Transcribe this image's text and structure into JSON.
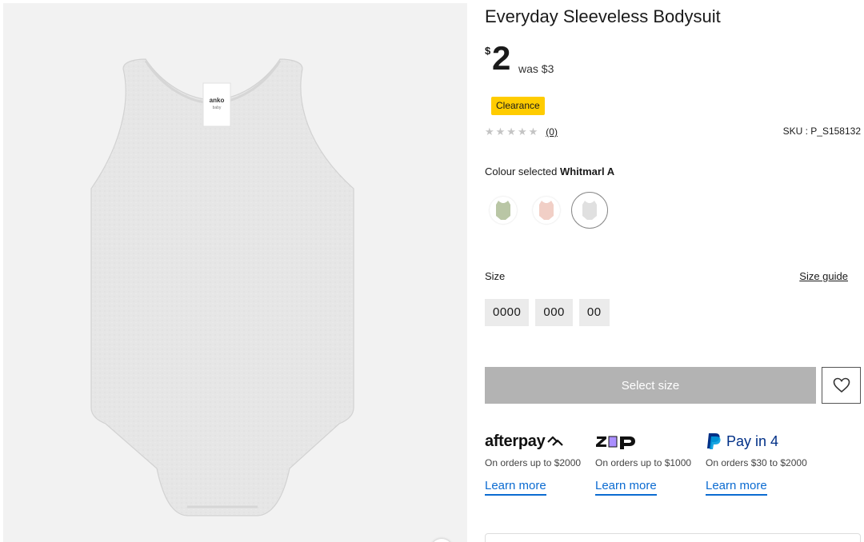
{
  "product": {
    "title": "Everyday Sleeveless Bodysuit",
    "price_currency": "$",
    "price": "2",
    "was_price": "was $3",
    "badge": "Clearance",
    "rating_stars": "★★★★★",
    "rating_count": "(0)",
    "sku": "SKU : P_S158132",
    "image_label_brand": "anko",
    "image_label_sub": "baby"
  },
  "colour": {
    "label": "Colour selected",
    "selected_name": "Whitmarl A",
    "swatches": [
      {
        "name": "green",
        "color": "#b9c6a5"
      },
      {
        "name": "pink",
        "color": "#f1cfc6"
      },
      {
        "name": "whitmarl",
        "color": "#e4e4e4"
      }
    ]
  },
  "size": {
    "label": "Size",
    "guide_link": "Size guide",
    "options": [
      "0000",
      "000",
      "00"
    ]
  },
  "actions": {
    "select_size": "Select size",
    "wishlist_icon": "heart-icon"
  },
  "payments": [
    {
      "logo_text": "afterpay",
      "note": "On orders up to $2000",
      "link": "Learn more"
    },
    {
      "logo_text": "zip",
      "note": "On orders up to $1000",
      "link": "Learn more"
    },
    {
      "logo_text": "Pay in 4",
      "note": "On orders $30 to $2000",
      "link": "Learn more"
    }
  ],
  "colors": {
    "badge_bg": "#ffcc00",
    "link_blue": "#0b6bd1",
    "button_disabled": "#b3b3b3",
    "paypal_dark": "#003087",
    "paypal_light": "#009cde",
    "zip_purple": "#aa8fff"
  }
}
